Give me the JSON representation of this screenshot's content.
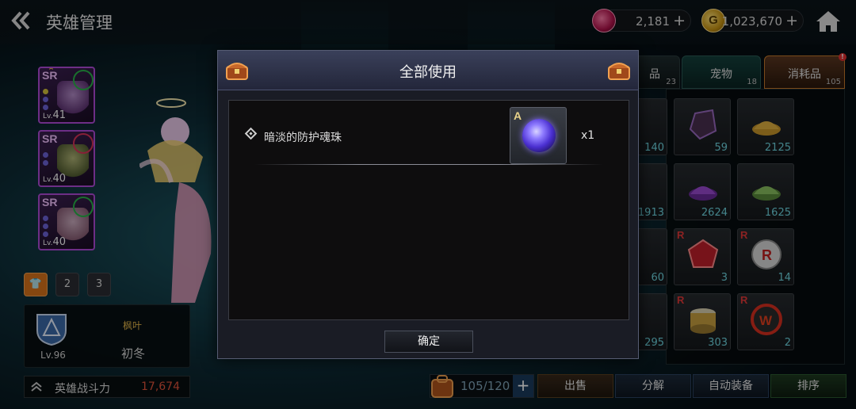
{
  "header": {
    "title": "英雄管理",
    "gems": "2,181",
    "gold": "1,023,670",
    "gold_icon_letter": "G"
  },
  "heroes": [
    {
      "rank": "SR",
      "level_prefix": "Lv.",
      "level": "41",
      "element_color": "#29b34a"
    },
    {
      "rank": "SR",
      "level_prefix": "Lv.",
      "level": "40",
      "element_color": "#d8345a"
    },
    {
      "rank": "SR",
      "level_prefix": "Lv.",
      "level": "40",
      "element_color": "#29b34a"
    }
  ],
  "costume_slots": [
    "",
    "2",
    "3"
  ],
  "guild": {
    "level": "Lv.96",
    "name_top": "枫叶",
    "name_main": "初冬"
  },
  "power": {
    "label": "英雄战斗力",
    "value": "17,674"
  },
  "inventory": {
    "tabs": [
      {
        "label": "品",
        "count": "23"
      },
      {
        "label": "宠物",
        "count": "18"
      },
      {
        "label": "消耗品",
        "count": "105",
        "alert": "!"
      }
    ],
    "items": [
      {
        "count": "140",
        "rank": ""
      },
      {
        "count": "59",
        "rank": ""
      },
      {
        "count": "2125",
        "rank": ""
      },
      {
        "count": "1913",
        "rank": ""
      },
      {
        "count": "2624",
        "rank": ""
      },
      {
        "count": "1625",
        "rank": ""
      },
      {
        "count": "60",
        "rank": ""
      },
      {
        "count": "3",
        "rank": "R"
      },
      {
        "count": "14",
        "rank": "R"
      },
      {
        "count": "295",
        "rank": ""
      },
      {
        "count": "303",
        "rank": "R"
      },
      {
        "count": "2",
        "rank": "R"
      }
    ]
  },
  "bottom": {
    "bag_count": "105/120",
    "bag_plus": "+",
    "sell": "出售",
    "disassemble": "分解",
    "auto_equip": "自动装备",
    "sort": "排序"
  },
  "modal": {
    "title": "全部使用",
    "item_name": "暗淡的防护魂珠",
    "item_grade": "A",
    "quantity": "x1",
    "confirm": "确定"
  },
  "colors": {
    "accent_orange": "#d8731b",
    "power_red": "#e0533a",
    "item_count_cyan": "#6ed6e0"
  },
  "icons": [
    "back-arrow-icon",
    "gem-icon",
    "gold-coin-icon",
    "home-icon",
    "chest-icon",
    "blue-orb-icon"
  ]
}
